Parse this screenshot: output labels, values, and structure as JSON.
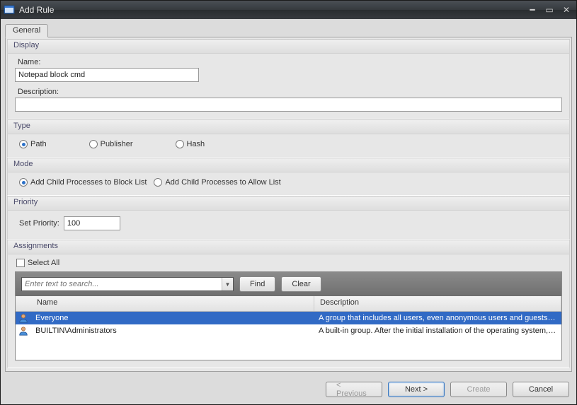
{
  "window": {
    "title": "Add Rule"
  },
  "tabs": {
    "general": "General"
  },
  "display": {
    "header": "Display",
    "name_label": "Name:",
    "name_value": "Notepad block cmd",
    "description_label": "Description:",
    "description_value": ""
  },
  "type": {
    "header": "Type",
    "options": {
      "path": "Path",
      "publisher": "Publisher",
      "hash": "Hash"
    },
    "selected": "path"
  },
  "mode": {
    "header": "Mode",
    "options": {
      "block": "Add Child Processes to Block List",
      "allow": "Add Child Processes to Allow List"
    },
    "selected": "block"
  },
  "priority": {
    "header": "Priority",
    "label": "Set Priority:",
    "value": "100"
  },
  "assignments": {
    "header": "Assignments",
    "select_all": "Select All",
    "search_placeholder": "Enter text to search...",
    "find": "Find",
    "clear": "Clear",
    "columns": {
      "name": "Name",
      "description": "Description"
    },
    "rows": [
      {
        "name": "Everyone",
        "description": "A group that includes all users, even anonymous users and guests. Members...",
        "selected": true
      },
      {
        "name": "BUILTIN\\Administrators",
        "description": "A built-in group. After the initial installation of the operating system, the onl...",
        "selected": false
      }
    ]
  },
  "footer": {
    "previous": "< Previous",
    "next": "Next >",
    "create": "Create",
    "cancel": "Cancel"
  }
}
